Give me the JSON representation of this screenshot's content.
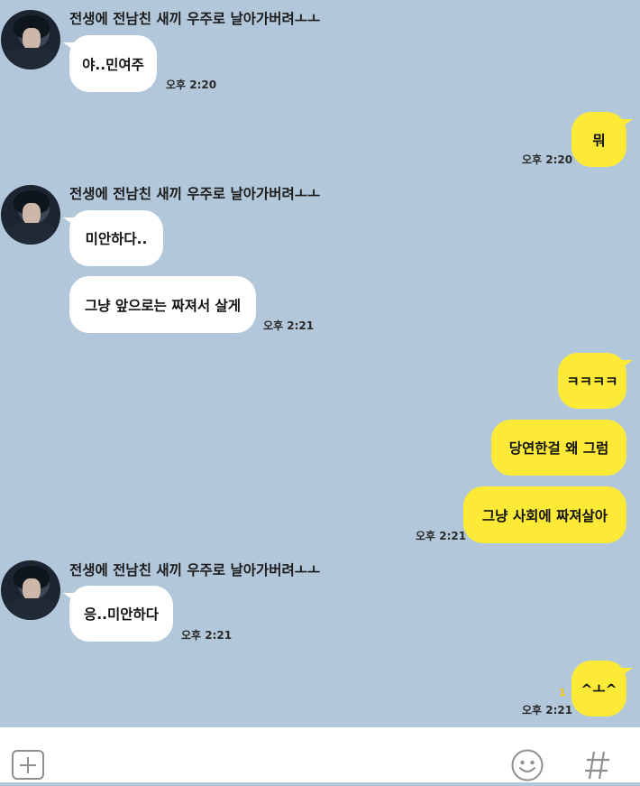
{
  "chat": {
    "contact_name": "전생에 전남친 새끼 우주로 날아가버려ㅗㅗ",
    "messages": [
      {
        "text": "야..민여주",
        "time": "오후 2:20"
      },
      {
        "text": "뭐",
        "time": "오후 2:20"
      },
      {
        "text": "미안하다.."
      },
      {
        "text": "그냥 앞으로는 짜져서 살게",
        "time": "오후 2:21"
      },
      {
        "text": "ㅋㅋㅋㅋ"
      },
      {
        "text": "당연한걸 왜 그럼"
      },
      {
        "text": "그냥 사회에 짜져살아",
        "time": "오후 2:21"
      },
      {
        "text": "응..미안하다",
        "time": "오후 2:21"
      },
      {
        "text": "^ㅗ^",
        "time": "오후 2:21",
        "unread": "1"
      }
    ]
  },
  "input_bar": {
    "icons": [
      "plus-icon",
      "emoji-icon",
      "hash-icon"
    ]
  },
  "colors": {
    "background": "#b2c7da",
    "incoming_bubble": "#ffffff",
    "outgoing_bubble": "#fdea36",
    "unread": "#f5c400"
  }
}
